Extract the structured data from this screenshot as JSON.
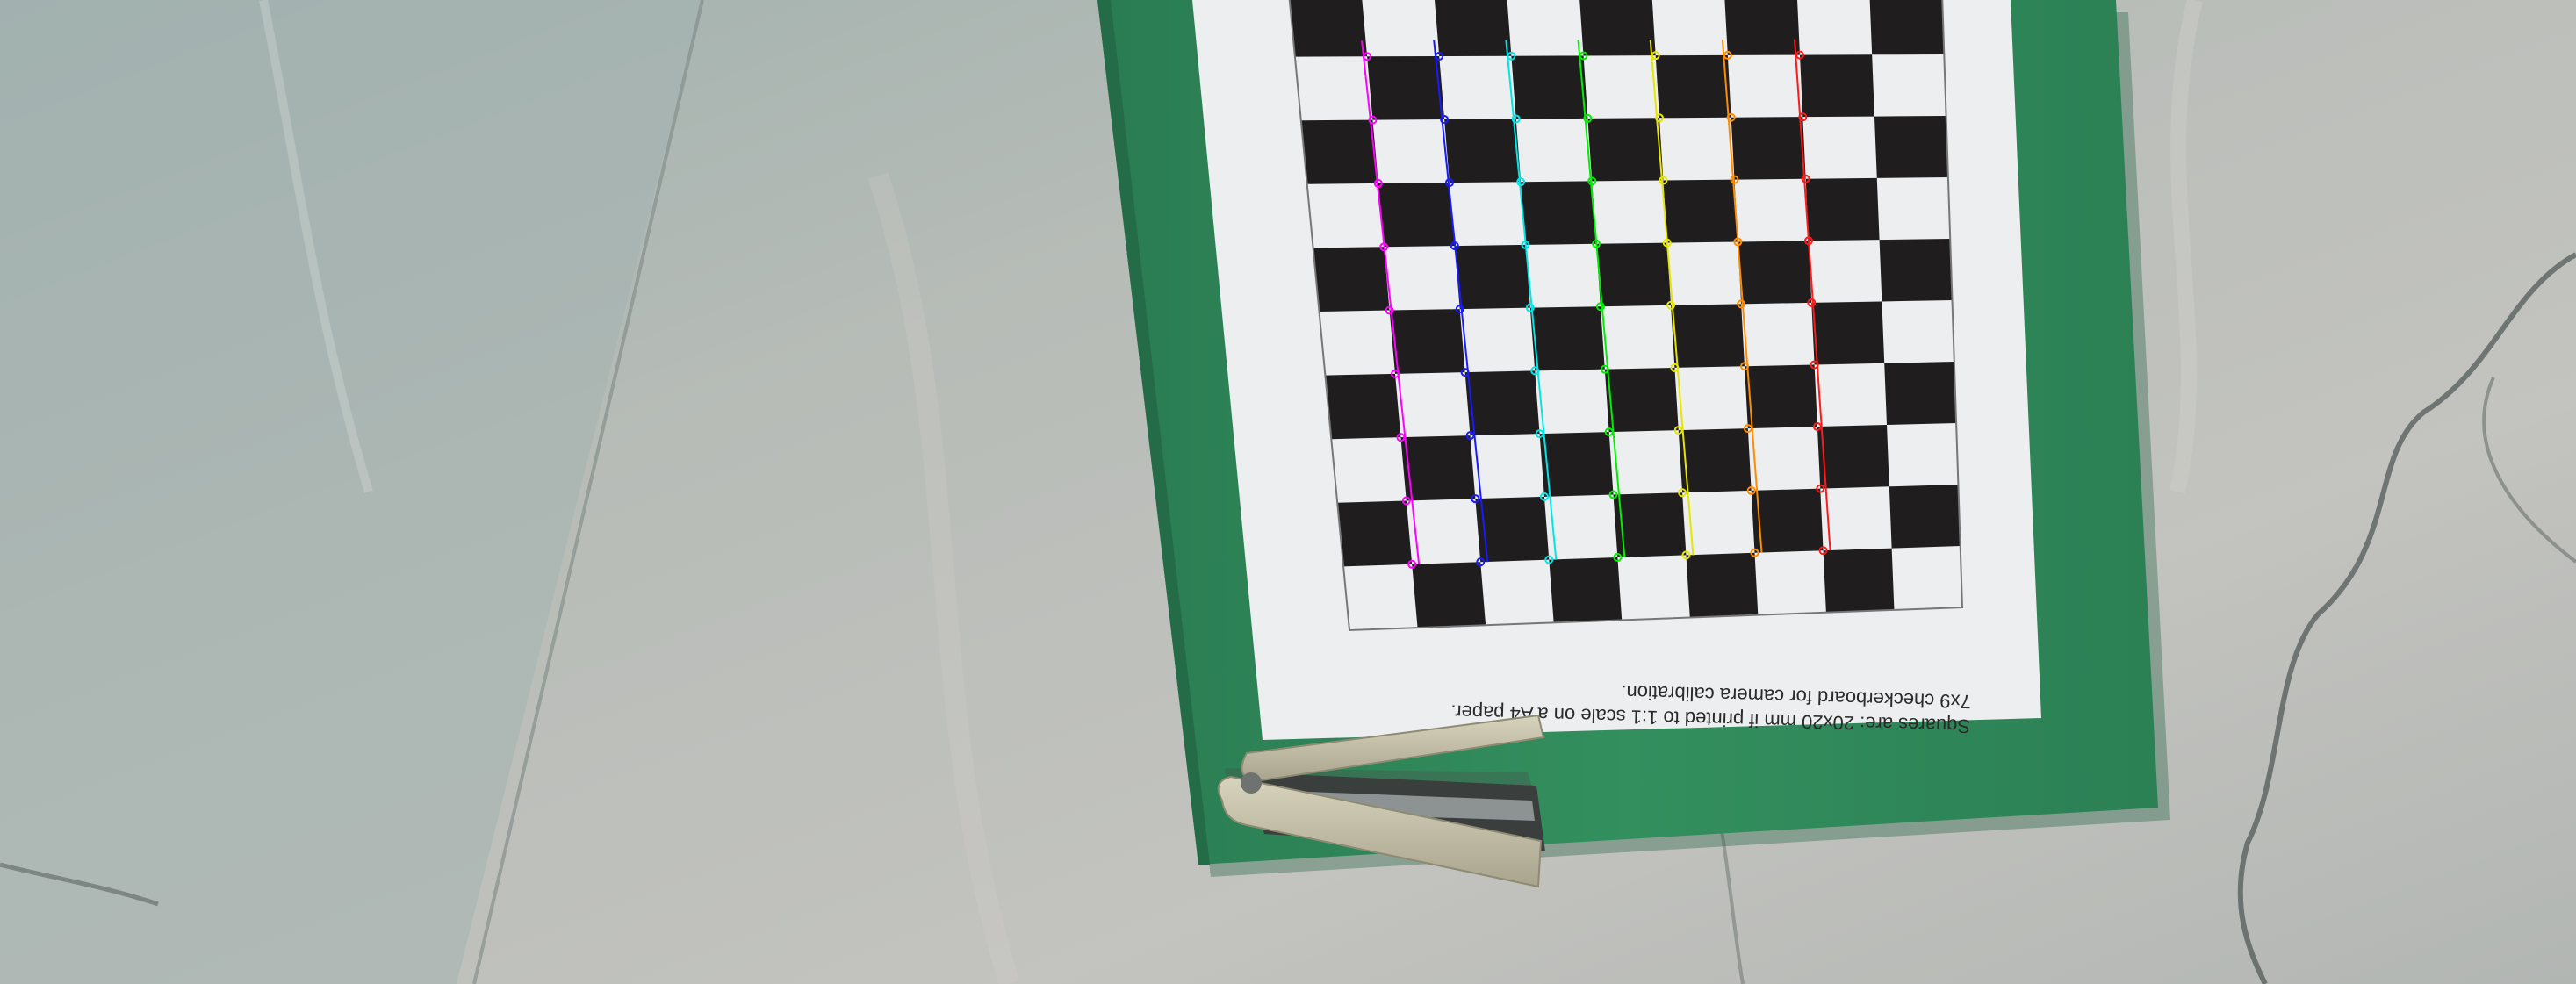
{
  "photo": {
    "caption_line_1": "7x9 checkerboard for camera calibration.",
    "caption_line_2": "Squares are: 20x20 mm if printed to 1:1 scale on a A4 paper.",
    "board": {
      "columns": 9,
      "rows": 10
    },
    "corner_line_colors": [
      "#ff00ff",
      "#1a1aff",
      "#00e5e5",
      "#00ee00",
      "#e5e500",
      "#ff8c00",
      "#ff1a1a"
    ],
    "colors": {
      "marble": "#b9bcb6",
      "clipboard": "#2f8a5a",
      "paper": "#e8e8ec",
      "square_dark": "#1f1d1d",
      "stapler": "#c9c4ad"
    },
    "objects": [
      "marble-floor",
      "green-clipboard",
      "calibration-checkerboard",
      "stapler"
    ]
  }
}
